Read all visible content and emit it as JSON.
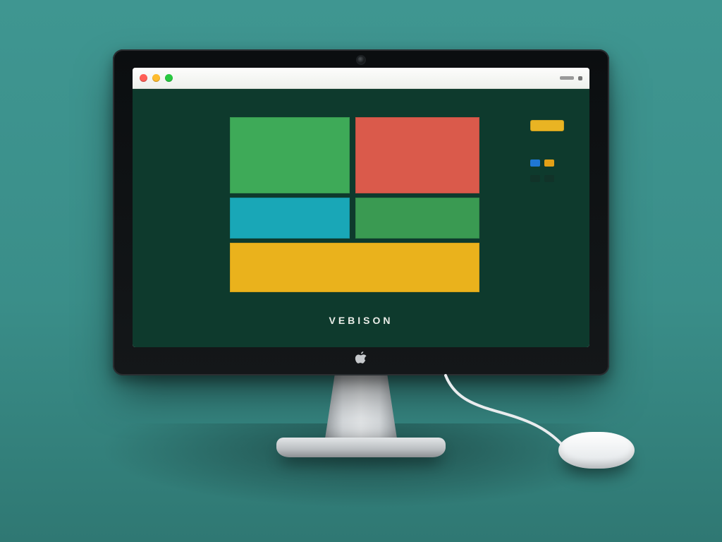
{
  "window": {
    "traffic_lights": {
      "close": "close",
      "minimize": "minimize",
      "zoom": "zoom"
    }
  },
  "app": {
    "caption": "VEBISON"
  },
  "tiles": {
    "green1": "#3eaa58",
    "red": "#da5a4b",
    "cyan": "#19a7b7",
    "green2": "#3a9a52",
    "yellow": "#eab21c"
  },
  "side": {
    "chip_gold": "#e9b423",
    "pill_blue": "#1f77d4",
    "pill_amber": "#e2a017"
  }
}
